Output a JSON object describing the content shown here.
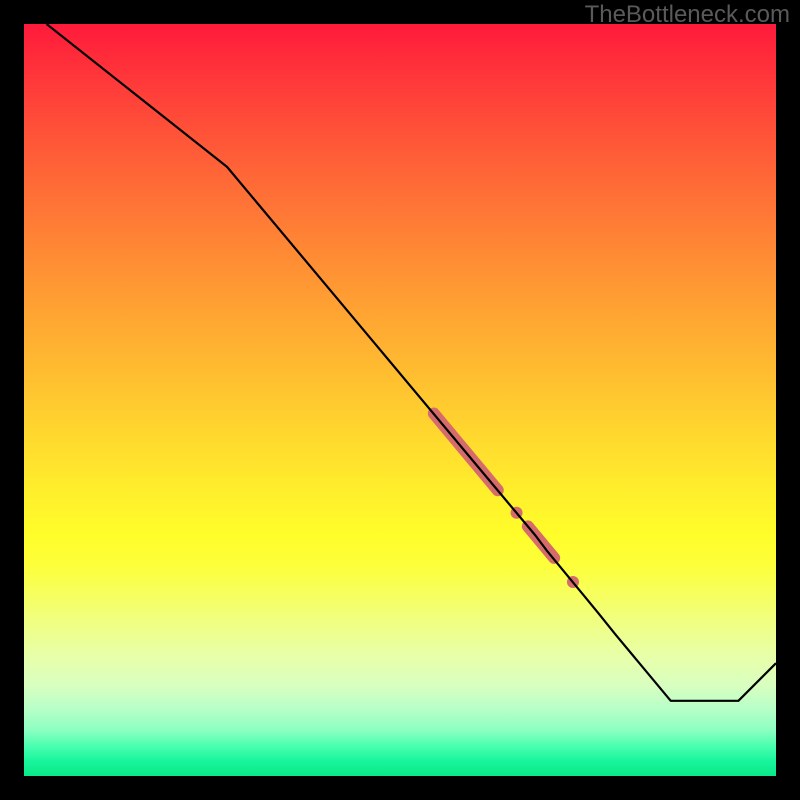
{
  "watermark": "TheBottleneck.com",
  "chart_data": {
    "type": "line",
    "title": "",
    "xlabel": "",
    "ylabel": "",
    "xlim": [
      0,
      100
    ],
    "ylim": [
      0,
      100
    ],
    "series": [
      {
        "name": "curve",
        "x": [
          3,
          27,
          68,
          69.5,
          74.7,
          76.5,
          78.5,
          86,
          95,
          100
        ],
        "values": [
          100,
          81,
          32,
          30,
          23.7,
          21.5,
          19,
          10,
          10,
          15
        ],
        "color": "#000000",
        "width": 2.2
      }
    ],
    "markers": [
      {
        "type": "segment",
        "x1": 54.5,
        "y1": 48.2,
        "x2": 63,
        "y2": 38,
        "color": "#d66b6b",
        "width": 12
      },
      {
        "type": "dot",
        "x": 65.5,
        "y": 35,
        "r": 6,
        "color": "#d66b6b"
      },
      {
        "type": "segment",
        "x1": 67,
        "y1": 33.2,
        "x2": 70.5,
        "y2": 29,
        "color": "#d66b6b",
        "width": 12
      },
      {
        "type": "dot",
        "x": 73,
        "y": 25.8,
        "r": 6,
        "color": "#d66b6b"
      }
    ],
    "gradient_stops": [
      {
        "pos": 0.0,
        "color": "#ff1a3b"
      },
      {
        "pos": 0.5,
        "color": "#ffd92e"
      },
      {
        "pos": 0.72,
        "color": "#fdff3a"
      },
      {
        "pos": 1.0,
        "color": "#0ae888"
      }
    ]
  }
}
